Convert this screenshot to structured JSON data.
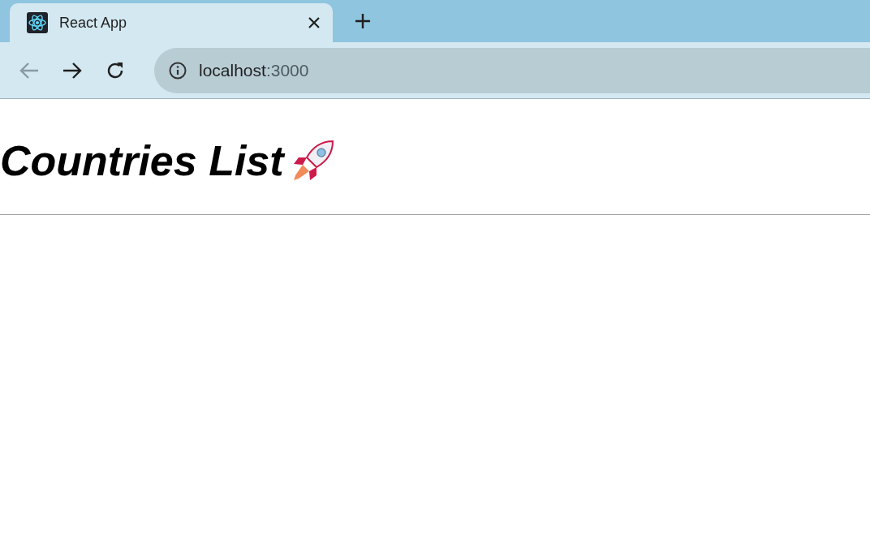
{
  "tab": {
    "title": "React App",
    "selected": true
  },
  "toolbar": {
    "back": {
      "disabled": true
    },
    "forward": {
      "disabled": false
    }
  },
  "address": {
    "host": "localhost",
    "rest": ":3000"
  },
  "page": {
    "heading": "Countries List"
  }
}
